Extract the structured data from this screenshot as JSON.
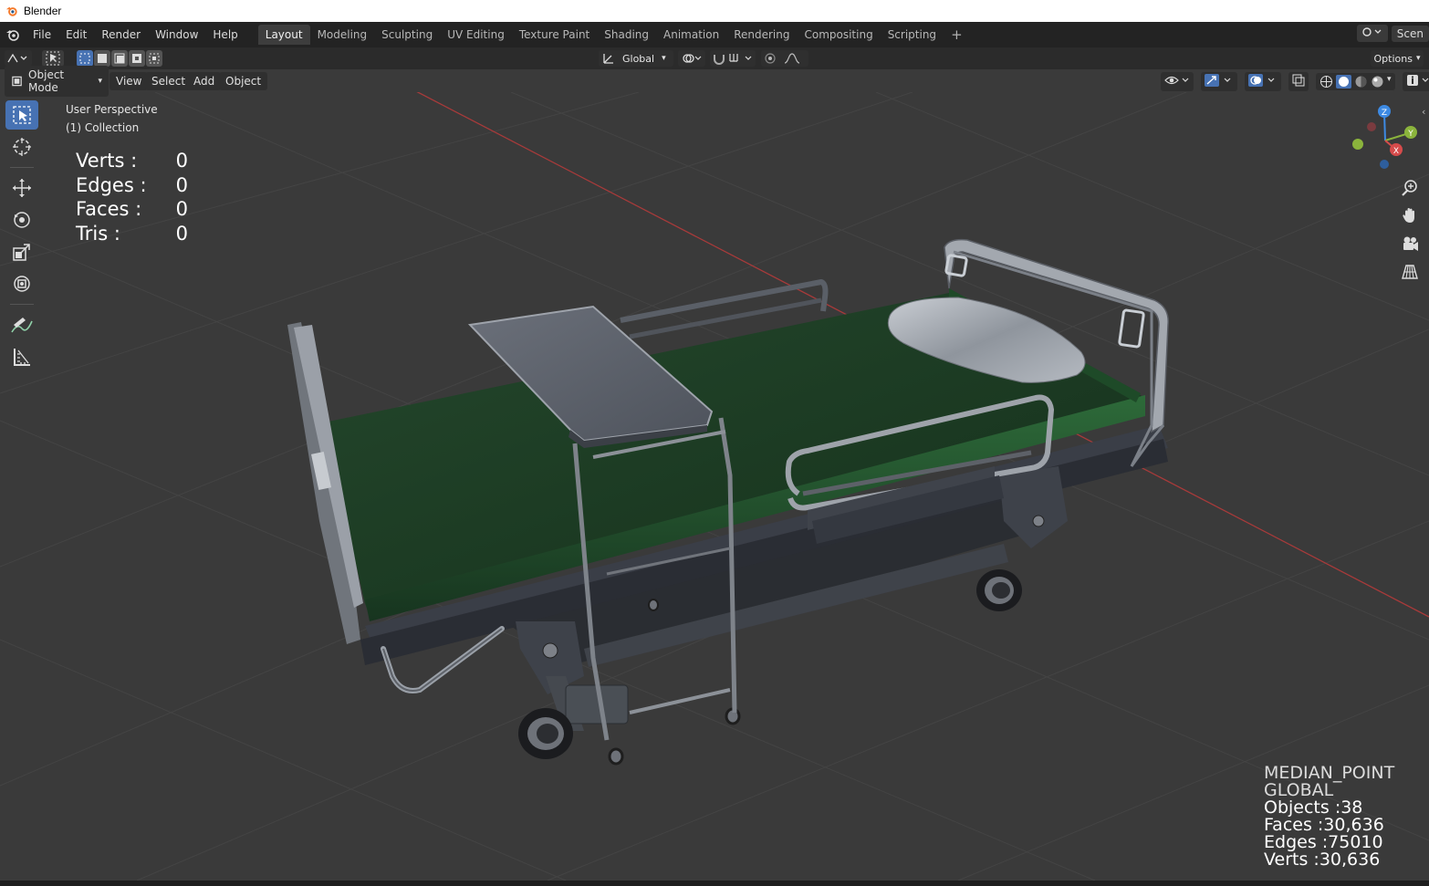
{
  "window": {
    "title": "Blender"
  },
  "menu": {
    "items": [
      "File",
      "Edit",
      "Render",
      "Window",
      "Help"
    ]
  },
  "workspaces": {
    "tabs": [
      "Layout",
      "Modeling",
      "Sculpting",
      "UV Editing",
      "Texture Paint",
      "Shading",
      "Animation",
      "Rendering",
      "Compositing",
      "Scripting"
    ],
    "active": "Layout",
    "add": "+"
  },
  "scene": {
    "label": "Scen"
  },
  "toolheader": {
    "orientation": "Global",
    "options": "Options"
  },
  "viewport_header": {
    "mode": "Object Mode",
    "menus": [
      "View",
      "Select",
      "Add",
      "Object"
    ]
  },
  "viewport_info": {
    "perspective": "User Perspective",
    "collection": "(1) Collection"
  },
  "selection_stats": {
    "rows": [
      {
        "label": "Verts :",
        "value": "0"
      },
      {
        "label": "Edges :",
        "value": "0"
      },
      {
        "label": "Faces :",
        "value": "0"
      },
      {
        "label": "Tris :",
        "value": "0"
      }
    ]
  },
  "scene_stats": {
    "pivot": "MEDIAN_POINT",
    "orientation": "GLOBAL",
    "objects": "Objects :38",
    "faces": "Faces :30,636",
    "edges": "Edges :75010",
    "verts": "Verts :30,636"
  },
  "gizmo": {
    "x": "X",
    "y": "Y",
    "z": "Z"
  },
  "colors": {
    "active_tool": "#4772b3",
    "viewport_bg": "#3a3a3a",
    "axis_x": "#d64b4b",
    "axis_y": "#8bb43c",
    "axis_z": "#3d8ae3",
    "mattress": "#1c3f26"
  },
  "icons": {
    "tools": [
      "select-box-icon",
      "cursor-icon",
      "move-icon",
      "rotate-icon",
      "scale-icon",
      "transform-icon",
      "annotate-icon",
      "measure-icon"
    ],
    "nav": [
      "zoom-icon",
      "pan-hand-icon",
      "camera-view-icon",
      "ortho-grid-icon"
    ]
  }
}
